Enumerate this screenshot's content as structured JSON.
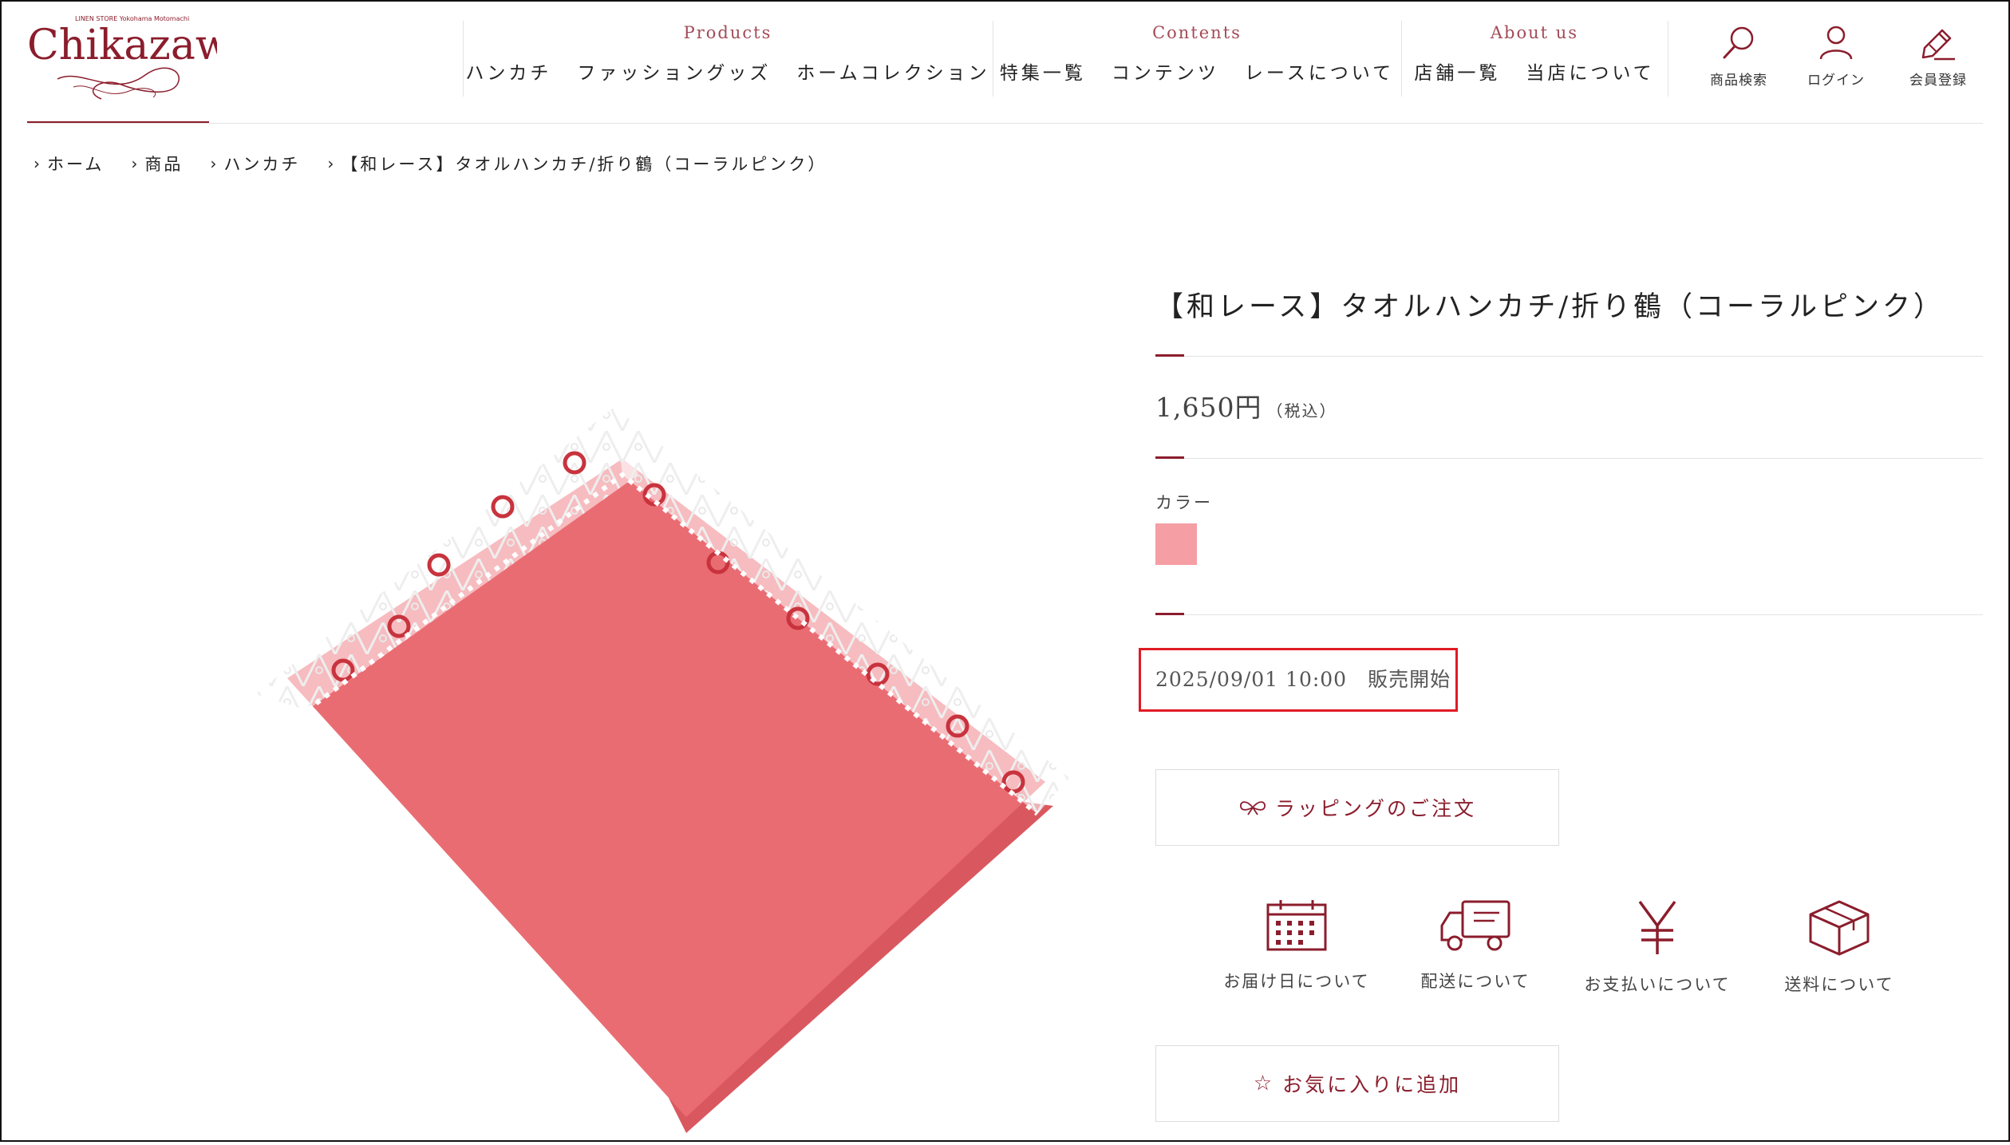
{
  "brand": {
    "logo_text": "Chikazawa",
    "logo_subtext": "LINEN STORE Yokohama Motomachi",
    "color": "#8b1d2c"
  },
  "nav": {
    "products": {
      "heading": "Products",
      "items": [
        "ハンカチ",
        "ファッショングッズ",
        "ホームコレクション"
      ]
    },
    "contents": {
      "heading": "Contents",
      "items": [
        "特集一覧",
        "コンテンツ",
        "レースについて"
      ]
    },
    "about": {
      "heading": "About us",
      "items": [
        "店舗一覧",
        "当店について"
      ]
    }
  },
  "header_icons": {
    "search": {
      "label": "商品検索",
      "icon": "search-icon"
    },
    "login": {
      "label": "ログイン",
      "icon": "user-icon"
    },
    "register": {
      "label": "会員登録",
      "icon": "pencil-icon"
    }
  },
  "breadcrumb": [
    "ホーム",
    "商品",
    "ハンカチ",
    "【和レース】タオルハンカチ/折り鶴（コーラルピンク）"
  ],
  "product": {
    "title": "【和レース】タオルハンカチ/折り鶴（コーラルピンク）",
    "price": "1,650円",
    "tax_note": "（税込）",
    "color_label": "カラー",
    "color_swatch": "#f59ea4",
    "sale_start": "2025/09/01 10:00　販売開始",
    "wrapping_button": "ラッピングのご注文",
    "favorite_button": "お気に入りに追加"
  },
  "info_links": [
    {
      "label": "お届け日について",
      "icon": "calendar-icon"
    },
    {
      "label": "配送について",
      "icon": "truck-icon"
    },
    {
      "label": "お支払いについて",
      "icon": "yen-icon"
    },
    {
      "label": "送料について",
      "icon": "box-icon"
    }
  ],
  "colors": {
    "accent": "#8b1d2c",
    "nav_heading": "#a34b57",
    "highlight_box": "#e01b25",
    "towel": "#e96a72"
  }
}
